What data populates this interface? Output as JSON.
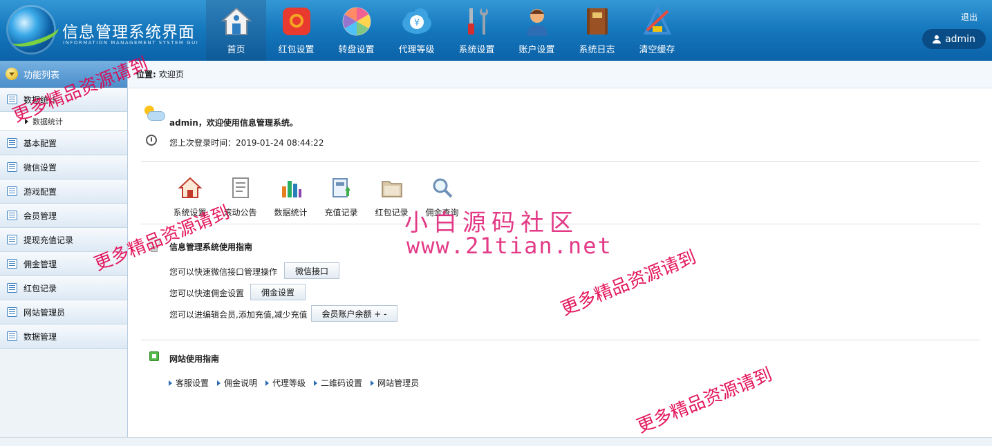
{
  "header": {
    "title": "信息管理系统界面",
    "subtitle": "INFORMATION MANAGEMENT SYSTEM GUI",
    "logout_label": "退出",
    "username": "admin",
    "nav": [
      {
        "label": "首页",
        "icon": "home-icon"
      },
      {
        "label": "红包设置",
        "icon": "red-packet-icon"
      },
      {
        "label": "转盘设置",
        "icon": "wheel-icon"
      },
      {
        "label": "代理等级",
        "icon": "yuan-cloud-icon"
      },
      {
        "label": "系统设置",
        "icon": "tools-icon"
      },
      {
        "label": "账户设置",
        "icon": "user-account-icon"
      },
      {
        "label": "系统日志",
        "icon": "book-icon"
      },
      {
        "label": "清空缓存",
        "icon": "clear-cache-icon"
      }
    ]
  },
  "sidebar": {
    "heading": "功能列表",
    "items": [
      {
        "label": "数据统计",
        "expanded": true,
        "children": [
          "数据统计"
        ]
      },
      {
        "label": "基本配置"
      },
      {
        "label": "微信设置"
      },
      {
        "label": "游戏配置"
      },
      {
        "label": "会员管理"
      },
      {
        "label": "提现充值记录"
      },
      {
        "label": "佣金管理"
      },
      {
        "label": "红包记录"
      },
      {
        "label": "网站管理员"
      },
      {
        "label": "数据管理"
      }
    ]
  },
  "breadcrumb": {
    "prefix": "位置:",
    "current": "欢迎页"
  },
  "welcome": {
    "greeting": "admin，欢迎使用信息管理系统。",
    "last_login": "您上次登录时间：2019-01-24 08:44:22"
  },
  "quick_links": [
    {
      "label": "系统设置",
      "icon": "house-icon"
    },
    {
      "label": "滚动公告",
      "icon": "notice-icon"
    },
    {
      "label": "数据统计",
      "icon": "bar-chart-icon"
    },
    {
      "label": "充值记录",
      "icon": "recharge-icon"
    },
    {
      "label": "红包记录",
      "icon": "folder-icon"
    },
    {
      "label": "佣金查询",
      "icon": "magnifier-icon"
    }
  ],
  "usage_guide": {
    "title": "信息管理系统使用指南",
    "rows": [
      {
        "text": "您可以快速微信接口管理操作",
        "button": "微信接口"
      },
      {
        "text": "您可以快速佣金设置",
        "button": "佣金设置"
      },
      {
        "text": "您可以进编辑会员,添加充值,减少充值",
        "button": "会员账户余额 + -"
      }
    ]
  },
  "site_guide": {
    "title": "网站使用指南",
    "links": [
      "客服设置",
      "佣金说明",
      "代理等级",
      "二维码设置",
      "网站管理员"
    ]
  },
  "watermarks": {
    "brand": "小白源码社区",
    "url": "www.21tian.net",
    "repeat": "更多精品资源请到"
  },
  "colors": {
    "header": "#0c62a8",
    "accent_pink": "#e0247a"
  }
}
